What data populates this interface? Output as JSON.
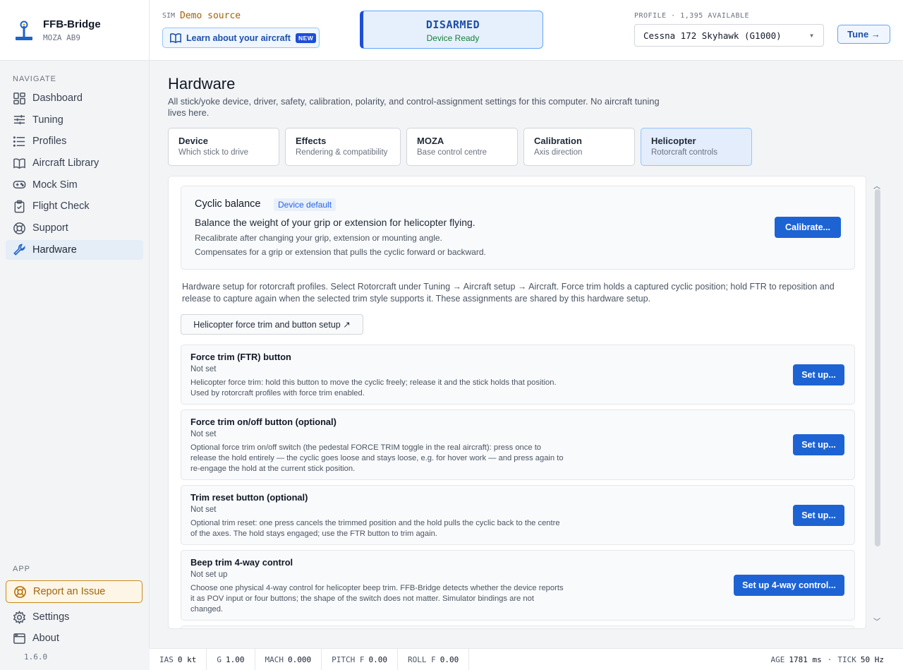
{
  "app": {
    "name": "FFB-Bridge",
    "device": "MOZA AB9",
    "version": "1.6.0"
  },
  "sidebar": {
    "navigate_heading": "NAVIGATE",
    "items": [
      {
        "label": "Dashboard",
        "icon": "dashboard-icon"
      },
      {
        "label": "Tuning",
        "icon": "sliders-icon"
      },
      {
        "label": "Profiles",
        "icon": "list-icon"
      },
      {
        "label": "Aircraft Library",
        "icon": "book-icon"
      },
      {
        "label": "Mock Sim",
        "icon": "gamepad-icon"
      },
      {
        "label": "Flight Check",
        "icon": "clipboard-icon"
      },
      {
        "label": "Support",
        "icon": "lifebuoy-icon"
      },
      {
        "label": "Hardware",
        "icon": "wrench-icon",
        "active": true
      }
    ],
    "app_heading": "APP",
    "report_issue": "Report an Issue",
    "settings": "Settings",
    "about": "About"
  },
  "topbar": {
    "sim_label": "SIM",
    "sim_value": "Demo source",
    "learn_label": "Learn about your aircraft",
    "new_badge": "NEW",
    "status_main": "DISARMED",
    "status_sub": "Device Ready",
    "profile_label": "PROFILE · 1,395 AVAILABLE",
    "profile_value": "Cessna 172 Skyhawk (G1000)",
    "tune_label": "Tune →"
  },
  "page": {
    "title": "Hardware",
    "description": "All stick/yoke device, driver, safety, calibration, polarity, and control-assignment settings for this computer. No aircraft tuning lives here.",
    "tabs": [
      {
        "title": "Device",
        "subtitle": "Which stick to drive"
      },
      {
        "title": "Effects",
        "subtitle": "Rendering & compatibility"
      },
      {
        "title": "MOZA",
        "subtitle": "Base control centre"
      },
      {
        "title": "Calibration",
        "subtitle": "Axis direction"
      },
      {
        "title": "Helicopter",
        "subtitle": "Rotorcraft controls",
        "active": true
      }
    ]
  },
  "cyclic": {
    "title": "Cyclic balance",
    "badge": "Device default",
    "line1": "Balance the weight of your grip or extension for helicopter flying.",
    "line2": "Recalibrate after changing your grip, extension or mounting angle.",
    "line3": "Compensates for a grip or extension that pulls the cyclic forward or backward.",
    "button": "Calibrate..."
  },
  "info": {
    "text": "Hardware setup for rotorcraft profiles. Select Rotorcraft under Tuning → Aircraft setup → Aircraft. Force trim holds a captured cyclic position; hold FTR to reposition and release to capture again when the selected trim style supports it. These assignments are shared by this hardware setup.",
    "button": "Helicopter force trim and button setup ↗"
  },
  "rows": [
    {
      "title": "Force trim (FTR) button",
      "status": "Not set",
      "desc": "Helicopter force trim: hold this button to move the cyclic freely; release it and the stick holds that position. Used by rotorcraft profiles with force trim enabled.",
      "button": "Set up..."
    },
    {
      "title": "Force trim on/off button (optional)",
      "status": "Not set",
      "desc": "Optional force trim on/off switch (the pedestal FORCE TRIM toggle in the real aircraft): press once to release the hold entirely — the cyclic goes loose and stays loose, e.g. for hover work — and press again to re-engage the hold at the current stick position.",
      "button": "Set up..."
    },
    {
      "title": "Trim reset button (optional)",
      "status": "Not set",
      "desc": "Optional trim reset: one press cancels the trimmed position and the hold pulls the cyclic back to the centre of the axes. The hold stays engaged; use the FTR button to trim again.",
      "button": "Set up..."
    },
    {
      "title": "Beep trim 4-way control",
      "status": "Not set up",
      "desc": "Choose one physical 4-way control for helicopter beep trim. FFB-Bridge detects whether the device reports it as POV input or four buttons; the shape of the switch does not matter. Simulator bindings are not changed.",
      "button": "Set up 4-way control..."
    }
  ],
  "statusbar": {
    "ias_label": "IAS",
    "ias_value": "0 kt",
    "g_label": "G",
    "g_value": "1.00",
    "mach_label": "MACH",
    "mach_value": "0.000",
    "pitch_label": "PITCH F",
    "pitch_value": "0.00",
    "roll_label": "ROLL F",
    "roll_value": "0.00",
    "age_label": "AGE",
    "age_value": "1781 ms",
    "tick_label": "TICK",
    "tick_value": "50 Hz"
  },
  "colors": {
    "accent": "#1d63d4",
    "warning": "#c98a1a",
    "ready": "#15803d"
  }
}
